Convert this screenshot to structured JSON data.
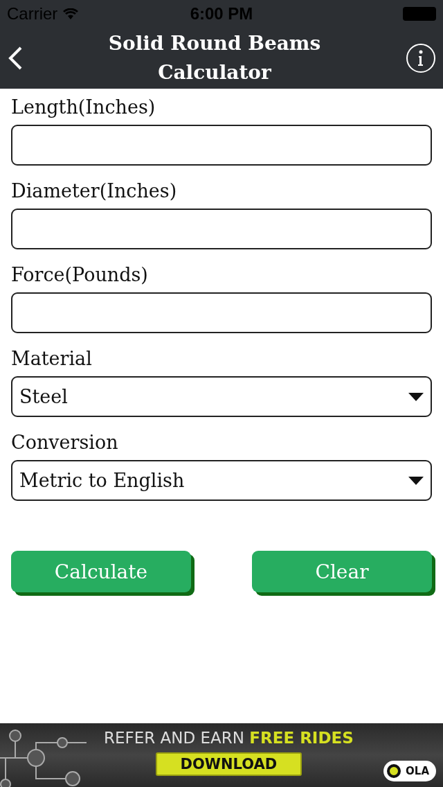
{
  "status_bar": {
    "carrier": "Carrier",
    "time": "6:00 PM"
  },
  "nav": {
    "title": "Solid Round Beams Calculator"
  },
  "fields": [
    {
      "kind": "text",
      "label": "Length(Inches)"
    },
    {
      "kind": "text",
      "label": "Diameter(Inches)"
    },
    {
      "kind": "text",
      "label": "Force(Pounds)"
    },
    {
      "kind": "select",
      "label": "Material",
      "value": "Steel"
    },
    {
      "kind": "select",
      "label": "Conversion",
      "value": "Metric to English"
    }
  ],
  "buttons": [
    "Calculate",
    "Clear"
  ],
  "ad": {
    "headline": "REFER AND EARN",
    "highlight": "FREE RIDES",
    "cta": "DOWNLOAD",
    "brand": "OLA"
  }
}
